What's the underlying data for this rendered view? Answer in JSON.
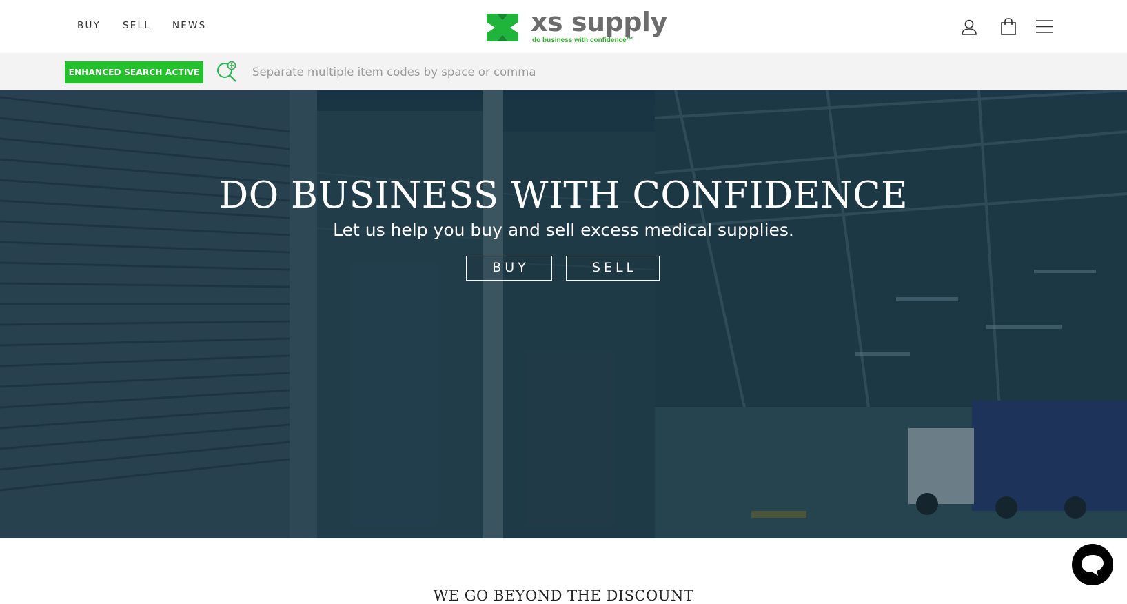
{
  "header": {
    "nav": [
      {
        "label": "BUY"
      },
      {
        "label": "SELL"
      },
      {
        "label": "NEWS"
      }
    ],
    "logo": {
      "name": "xs supply",
      "tagline": "do business with confidence™"
    },
    "icons": [
      "user-icon",
      "cart-icon",
      "menu-icon"
    ]
  },
  "search": {
    "badge_label": "ENHANCED SEARCH ACTIVE",
    "placeholder": "Separate multiple item codes by space or comma",
    "value": "",
    "icon": "search-plus-icon"
  },
  "hero": {
    "title": "DO BUSINESS WITH CONFIDENCE",
    "subtitle": "Let us help you buy and sell excess medical supplies.",
    "buttons": [
      {
        "label": "BUY"
      },
      {
        "label": "SELL"
      }
    ]
  },
  "section": {
    "heading": "WE GO BEYOND THE DISCOUNT"
  },
  "chat": {
    "icon": "chat-bubble-icon"
  },
  "colors": {
    "brand_green": "#22c32a",
    "logo_gray": "#6c6c6c",
    "search_bar_bg": "#f3f3f3",
    "hero_tint": "#22404f"
  }
}
